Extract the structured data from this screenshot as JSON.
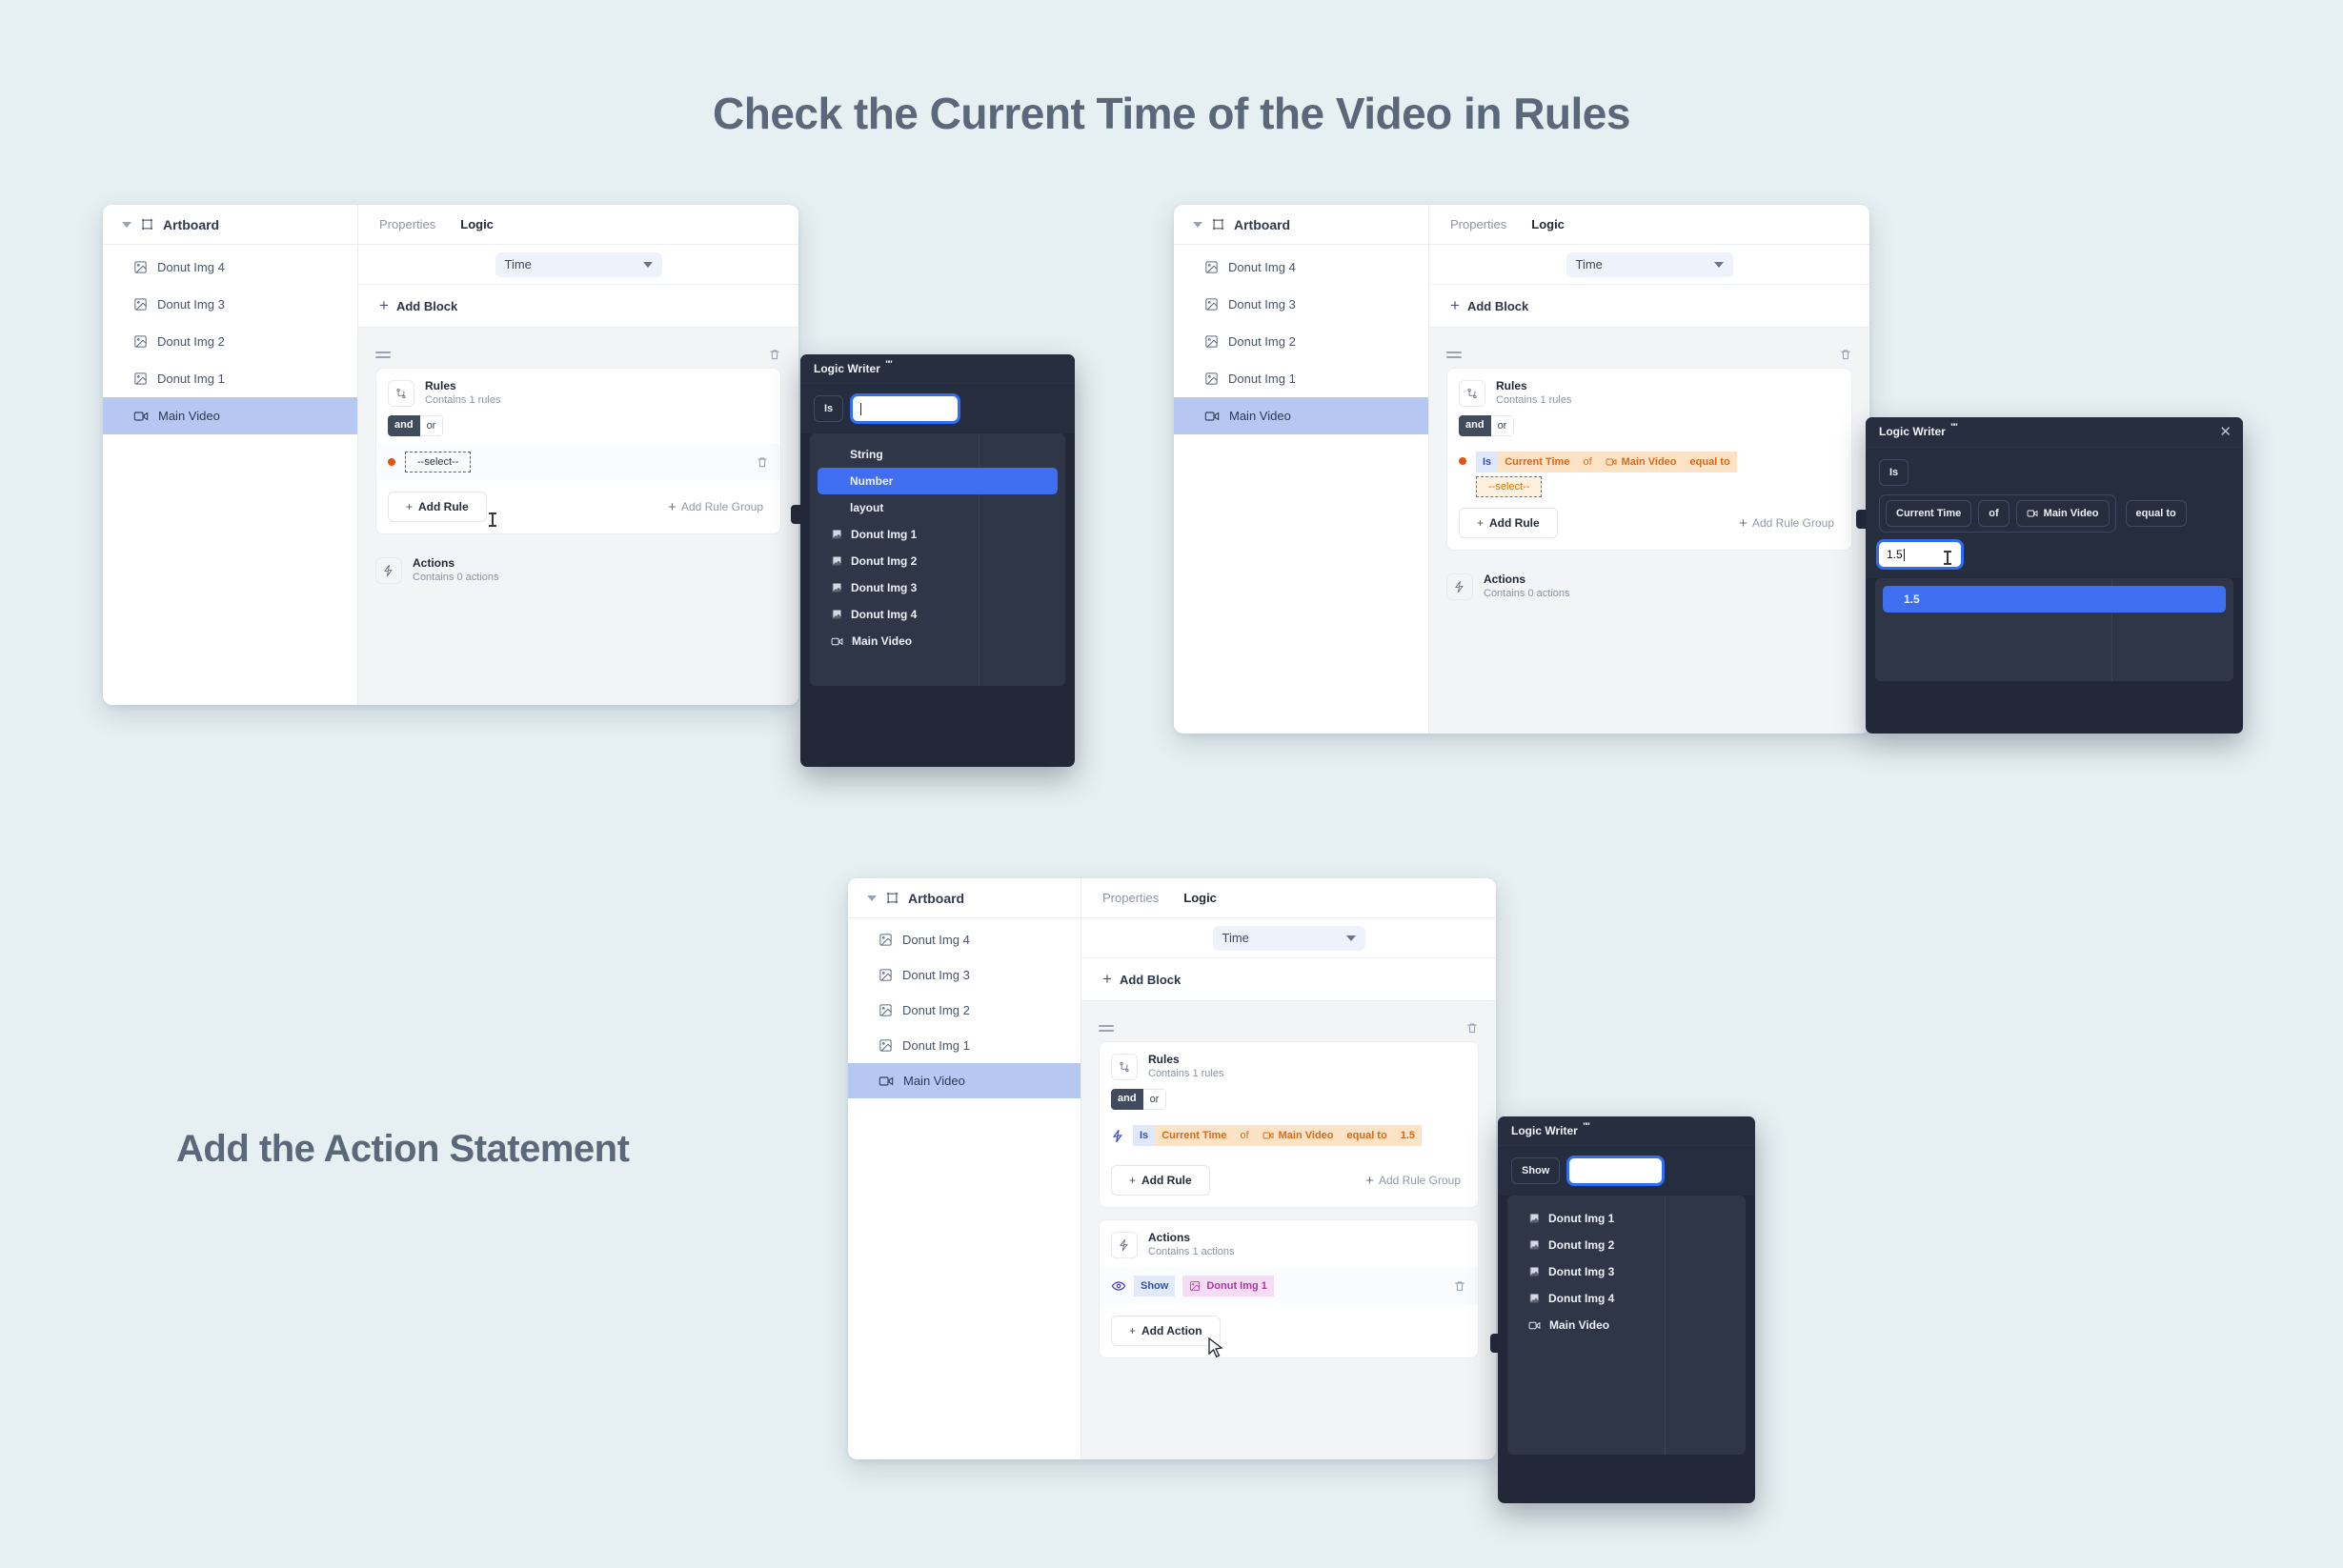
{
  "headings": {
    "top": "Check the Current Time of the Video in Rules",
    "bottom": "Add the Action Statement"
  },
  "colors": {
    "page_bg": "#e6eff1",
    "heading": "#5b6879",
    "sidebar_selected": "#b6c7f2",
    "accent_blue": "#3f6ef0",
    "token_amber_bg": "#fde3c6",
    "token_amber_text": "#d8691a",
    "token_is_bg": "#dfe8fb",
    "token_is_text": "#3152a8",
    "token_pink_bg": "#f4dcf4",
    "token_pink_text": "#b0399f",
    "bullet_red": "#e8500f",
    "popup_bg": "#222838"
  },
  "sidebar": {
    "header": "Artboard",
    "items": [
      {
        "label": "Donut Img 4",
        "icon": "image-icon",
        "selected": false
      },
      {
        "label": "Donut Img 3",
        "icon": "image-icon",
        "selected": false
      },
      {
        "label": "Donut Img 2",
        "icon": "image-icon",
        "selected": false
      },
      {
        "label": "Donut Img 1",
        "icon": "image-icon",
        "selected": false
      },
      {
        "label": "Main Video",
        "icon": "video-icon",
        "selected": true
      }
    ]
  },
  "editor": {
    "tabs": [
      {
        "label": "Properties",
        "active": false
      },
      {
        "label": "Logic",
        "active": true
      }
    ],
    "block_select": "Time",
    "add_block": "Add Block",
    "rules": {
      "title": "Rules",
      "subtitle": "Contains 1 rules",
      "and_label": "and",
      "or_label": "or",
      "add_rule": "Add Rule",
      "add_rule_group": "Add Rule Group",
      "select_placeholder": "--select--"
    },
    "actions": {
      "title": "Actions",
      "subtitle_empty": "Contains 0 actions",
      "subtitle_one": "Contains 1 actions",
      "add_action": "Add Action"
    },
    "rule_tokens": {
      "is": "Is",
      "current_time": "Current Time",
      "of": "of",
      "main_video": "Main Video",
      "equal_to": "equal to",
      "value": "1.5"
    },
    "action_tokens": {
      "show": "Show",
      "target": "Donut Img 1"
    }
  },
  "logic_writer_1": {
    "title": "Logic Writer",
    "is_label": "Is",
    "input_value": "",
    "options": [
      {
        "label": "String",
        "icon": null,
        "selected": false,
        "nested": true
      },
      {
        "label": "Number",
        "icon": null,
        "selected": true,
        "nested": true
      },
      {
        "label": "layout",
        "icon": null,
        "selected": false,
        "nested": true
      },
      {
        "label": "Donut Img 1",
        "icon": "image-icon",
        "selected": false,
        "nested": false
      },
      {
        "label": "Donut Img 2",
        "icon": "image-icon",
        "selected": false,
        "nested": false
      },
      {
        "label": "Donut Img 3",
        "icon": "image-icon",
        "selected": false,
        "nested": false
      },
      {
        "label": "Donut Img 4",
        "icon": "image-icon",
        "selected": false,
        "nested": false
      },
      {
        "label": "Main Video",
        "icon": "video-icon",
        "selected": false,
        "nested": false
      }
    ]
  },
  "logic_writer_2": {
    "title": "Logic Writer",
    "close": "✕",
    "is_label": "Is",
    "chips": {
      "current_time": "Current Time",
      "of": "of",
      "main_video": "Main Video",
      "equal_to": "equal to"
    },
    "input_value": "1.5",
    "options": [
      {
        "label": "1.5",
        "selected": true
      }
    ]
  },
  "logic_writer_3": {
    "title": "Logic Writer",
    "show_label": "Show",
    "input_value": "",
    "options": [
      {
        "label": "Donut Img 1",
        "icon": "image-icon",
        "selected": false
      },
      {
        "label": "Donut Img 2",
        "icon": "image-icon",
        "selected": false
      },
      {
        "label": "Donut Img 3",
        "icon": "image-icon",
        "selected": false
      },
      {
        "label": "Donut Img 4",
        "icon": "image-icon",
        "selected": false
      },
      {
        "label": "Main Video",
        "icon": "video-icon",
        "selected": false
      }
    ]
  },
  "icons": {
    "artboard": "artboard-icon",
    "image": "image-icon",
    "video": "video-icon",
    "rules": "branch-icon",
    "actions": "lightning-icon",
    "trash": "trash-icon",
    "grip": "drag-handle-icon",
    "eye": "eye-icon",
    "plus": "plus-icon",
    "chevron_down": "chevron-down-icon"
  }
}
